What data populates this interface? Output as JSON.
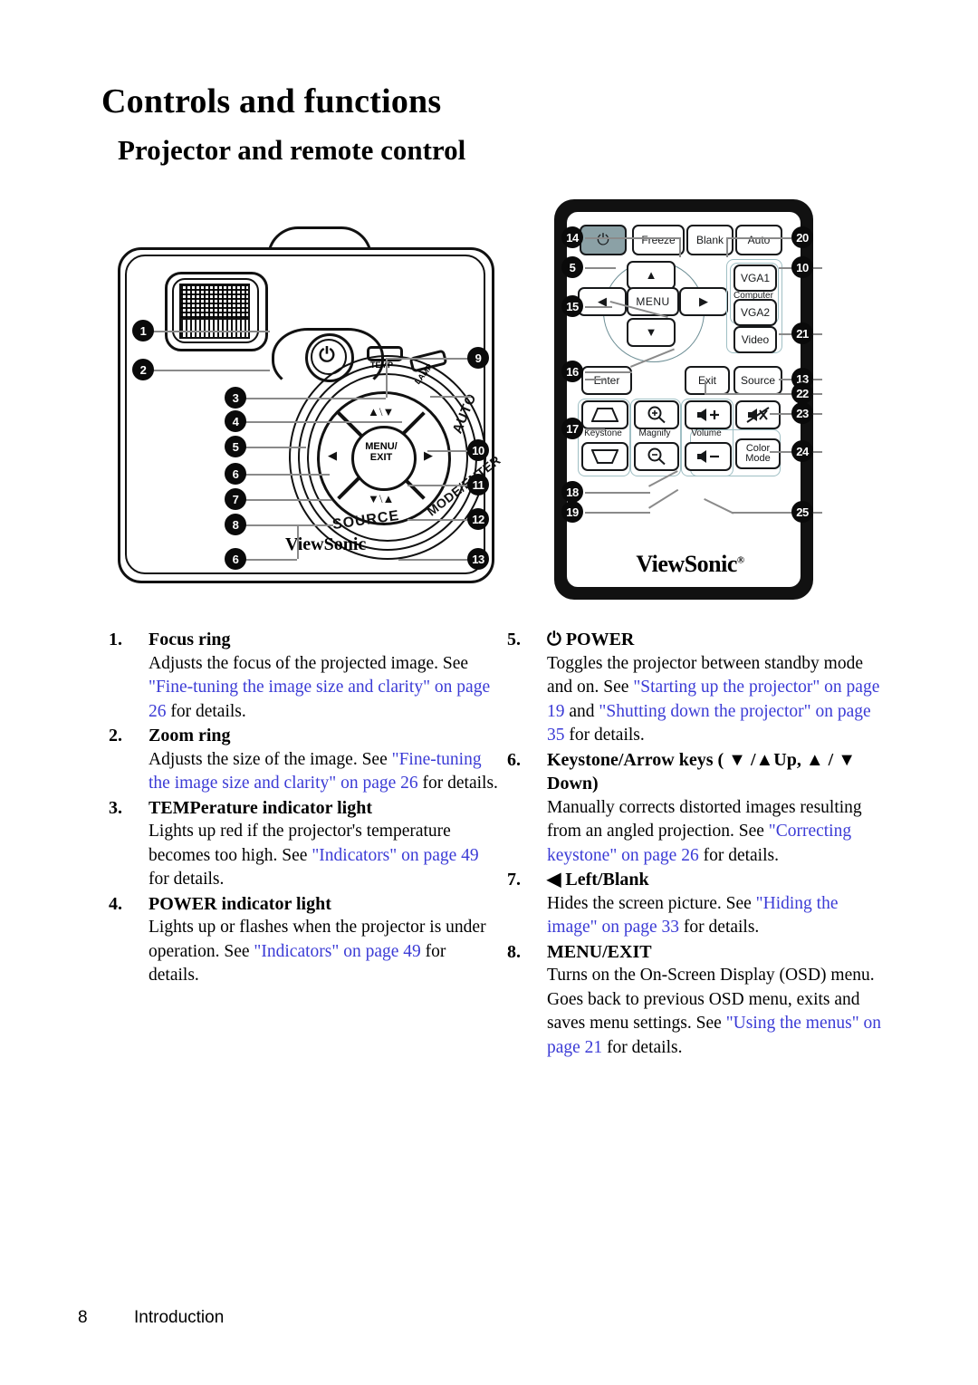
{
  "page": {
    "title": "Controls and functions",
    "section_title": "Projector and remote control",
    "footer_page_number": "8",
    "footer_label": "Introduction",
    "link_color": "#3b3bd6",
    "remote_shell_color": "#111111",
    "power_key_color": "#8ba1a6"
  },
  "projector": {
    "brand": "ViewSonic",
    "indicators": {
      "temp": "TEMP",
      "lamp": "LAMP"
    },
    "panel_keys": {
      "menu_exit_line1": "MENU/",
      "menu_exit_line2": "EXIT",
      "auto": "AUTO",
      "mode_enter": "MODE/ENTER",
      "source": "SOURCE",
      "power_glyph": "⏻"
    },
    "callouts": [
      "1",
      "2",
      "3",
      "4",
      "5",
      "6",
      "7",
      "8",
      "6",
      "9",
      "10",
      "11",
      "12",
      "13"
    ]
  },
  "remote": {
    "brand": "ViewSonic",
    "brand_mark": "®",
    "buttons": {
      "power": "⏻",
      "freeze": "Freeze",
      "blank": "Blank",
      "auto": "Auto",
      "up": "▲",
      "down": "▼",
      "left": "◀",
      "right": "▶",
      "menu": "MENU",
      "vga1": "VGA1",
      "vga2": "VGA2",
      "video": "Video",
      "computer_label": "Computer",
      "enter": "Enter",
      "exit": "Exit",
      "source": "Source",
      "keystone_label": "Keystone",
      "magnify_label": "Magnify",
      "volume_label": "Volume",
      "magnify_in": "⊕",
      "magnify_out": "⊖",
      "volume_up": "+",
      "volume_down": "–",
      "mute": "mute-icon",
      "color_mode_line1": "Color",
      "color_mode_line2": "Mode"
    },
    "callouts_left": [
      "14",
      "5",
      "15",
      "16",
      "17",
      "18",
      "19"
    ],
    "callouts_right": [
      "20",
      "10",
      "21",
      "13",
      "22",
      "23",
      "24",
      "25"
    ]
  },
  "items_left": [
    {
      "num": "1.",
      "title": "Focus ring",
      "desc_parts": [
        {
          "text": "Adjusts the focus of the projected image. See ",
          "link": false
        },
        {
          "text": "\"Fine-tuning the image size and clarity\" on page 26",
          "link": true
        },
        {
          "text": " for details.",
          "link": false
        }
      ]
    },
    {
      "num": "2.",
      "title": "Zoom ring",
      "desc_parts": [
        {
          "text": "Adjusts the size of the image. See ",
          "link": false
        },
        {
          "text": "\"Fine-tuning the image size and clarity\" on page 26",
          "link": true
        },
        {
          "text": " for details.",
          "link": false
        }
      ]
    },
    {
      "num": "3.",
      "title": "TEMPerature indicator light",
      "desc_parts": [
        {
          "text": "Lights up red if the projector's temperature becomes too high. See ",
          "link": false
        },
        {
          "text": "\"Indicators\" on page 49",
          "link": true
        },
        {
          "text": " for details.",
          "link": false
        }
      ]
    },
    {
      "num": "4.",
      "title": "POWER indicator light",
      "desc_parts": [
        {
          "text": "Lights up or flashes when the projector is under operation. See ",
          "link": false
        },
        {
          "text": "\"Indicators\" on page 49",
          "link": true
        },
        {
          "text": " for details.",
          "link": false
        }
      ]
    }
  ],
  "items_right": [
    {
      "num": "5.",
      "title": "⏻ POWER",
      "desc_parts": [
        {
          "text": "Toggles the projector between standby mode and on. See ",
          "link": false
        },
        {
          "text": "\"Starting up the projector\" on page 19",
          "link": true
        },
        {
          "text": " and ",
          "link": false
        },
        {
          "text": "\"Shutting down the projector\" on page 35",
          "link": true
        },
        {
          "text": " for details.",
          "link": false
        }
      ]
    },
    {
      "num": "6.",
      "title": "Keystone/Arrow keys ( ▼ /▲Up,  ▲ / ▼ Down)",
      "desc_parts": [
        {
          "text": "Manually corrects distorted images resulting from an angled projection. See ",
          "link": false
        },
        {
          "text": "\"Correcting keystone\" on page 26",
          "link": true
        },
        {
          "text": " for details.",
          "link": false
        }
      ]
    },
    {
      "num": "7.",
      "title": "◀ Left/Blank",
      "desc_parts": [
        {
          "text": "Hides the screen picture. See ",
          "link": false
        },
        {
          "text": "\"Hiding the image\" on page 33",
          "link": true
        },
        {
          "text": " for details.",
          "link": false
        }
      ]
    },
    {
      "num": "8.",
      "title": "MENU/EXIT",
      "desc_parts": [
        {
          "text": "Turns on the On-Screen Display (OSD) menu. Goes back to previous OSD menu, exits and saves menu settings. See ",
          "link": false
        },
        {
          "text": "\"Using the menus\" on page 21",
          "link": true
        },
        {
          "text": " for details.",
          "link": false
        }
      ]
    }
  ]
}
